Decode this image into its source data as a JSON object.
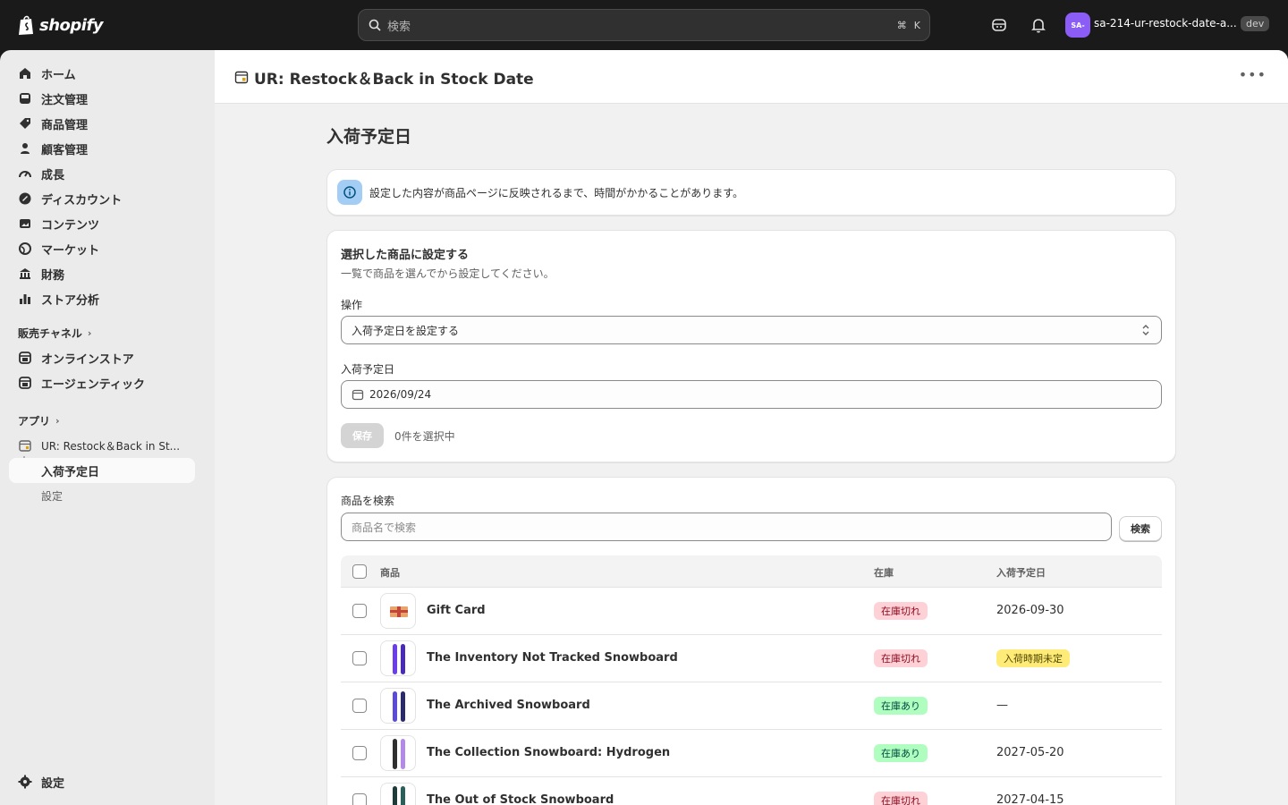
{
  "topbar": {
    "logo_text": "shopify",
    "search_placeholder": "検索",
    "shortcut_cmd": "⌘",
    "shortcut_key": "K",
    "store_initials": "SA-",
    "store_name": "sa-214-ur-restock-date-a...",
    "dev_badge": "dev"
  },
  "sidebar": {
    "items": [
      {
        "label": "ホーム",
        "icon": "home-icon"
      },
      {
        "label": "注文管理",
        "icon": "inbox-icon"
      },
      {
        "label": "商品管理",
        "icon": "tag-icon"
      },
      {
        "label": "顧客管理",
        "icon": "person-icon"
      },
      {
        "label": "成長",
        "icon": "gauge-icon"
      },
      {
        "label": "ディスカウント",
        "icon": "discount-icon"
      },
      {
        "label": "コンテンツ",
        "icon": "image-icon"
      },
      {
        "label": "マーケット",
        "icon": "globe-icon"
      },
      {
        "label": "財務",
        "icon": "bank-icon"
      },
      {
        "label": "ストア分析",
        "icon": "chart-icon"
      }
    ],
    "sales_channels_label": "販売チャネル",
    "channels": [
      {
        "label": "オンラインストア",
        "icon": "store-icon"
      },
      {
        "label": "エージェンティック",
        "icon": "store-icon"
      }
    ],
    "apps_label": "アプリ",
    "app_name": "UR: Restock＆Back in St...",
    "app_sub_active": "入荷予定日",
    "app_sub_settings": "設定",
    "settings_label": "設定"
  },
  "app_header": {
    "title": "UR: Restock＆Back in Stock Date"
  },
  "page": {
    "title": "入荷予定日",
    "banner_text": "設定した内容が商品ページに反映されるまで、時間がかかることがあります。"
  },
  "bulk_card": {
    "title": "選択した商品に設定する",
    "subtitle": "一覧で商品を選んでから設定してください。",
    "operation_label": "操作",
    "operation_value": "入荷予定日を設定する",
    "date_label": "入荷予定日",
    "date_value": "2026/09/24",
    "save_label": "保存",
    "selected_count": "0件を選択中"
  },
  "list_card": {
    "search_label": "商品を検索",
    "search_placeholder": "商品名で検索",
    "search_button": "検索",
    "columns": [
      "商品",
      "在庫",
      "入荷予定日"
    ],
    "rows": [
      {
        "name": "Gift Card",
        "stock": "在庫切れ",
        "stock_status": "out",
        "date": "2026-09-30"
      },
      {
        "name": "The Inventory Not Tracked Snowboard",
        "stock": "在庫切れ",
        "stock_status": "out",
        "date": "入荷時期未定"
      },
      {
        "name": "The Archived Snowboard",
        "stock": "在庫あり",
        "stock_status": "in",
        "date": "—"
      },
      {
        "name": "The Collection Snowboard: Hydrogen",
        "stock": "在庫あり",
        "stock_status": "in",
        "date": "2027-05-20"
      },
      {
        "name": "The Out of Stock Snowboard",
        "stock": "在庫切れ",
        "stock_status": "out",
        "date": "2027-04-15"
      }
    ]
  }
}
